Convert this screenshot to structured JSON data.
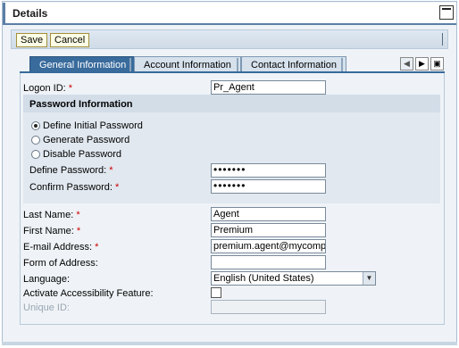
{
  "header": {
    "title": "Details"
  },
  "toolbar": {
    "save_label": "Save",
    "cancel_label": "Cancel"
  },
  "tabs": [
    {
      "label": "General Information",
      "active": true
    },
    {
      "label": "Account Information",
      "active": false
    },
    {
      "label": "Contact Information",
      "active": false
    }
  ],
  "form": {
    "logon_id": {
      "label": "Logon ID:",
      "required": "*",
      "value": "Pr_Agent"
    },
    "password_group": {
      "title": "Password Information",
      "options": [
        {
          "label": "Define Initial Password",
          "checked": true
        },
        {
          "label": "Generate Password",
          "checked": false
        },
        {
          "label": "Disable Password",
          "checked": false
        }
      ],
      "define_password": {
        "label": "Define Password:",
        "required": "*",
        "value": "•••••••"
      },
      "confirm_password": {
        "label": "Confirm Password:",
        "required": "*",
        "value": "•••••••"
      }
    },
    "last_name": {
      "label": "Last Name:",
      "required": "*",
      "value": "Agent"
    },
    "first_name": {
      "label": "First Name:",
      "required": "*",
      "value": "Premium"
    },
    "email": {
      "label": "E-mail Address:",
      "required": "*",
      "value": "premium.agent@mycompa"
    },
    "form_of_address": {
      "label": "Form of Address:",
      "value": ""
    },
    "language": {
      "label": "Language:",
      "value": "English (United States)"
    },
    "accessibility": {
      "label": "Activate Accessibility Feature:",
      "checked": false
    },
    "unique_id": {
      "label": "Unique ID:",
      "value": ""
    }
  },
  "colors": {
    "tab_active": "#396b9c",
    "required": "#cc0000",
    "panel_bg": "#eff3f7"
  }
}
